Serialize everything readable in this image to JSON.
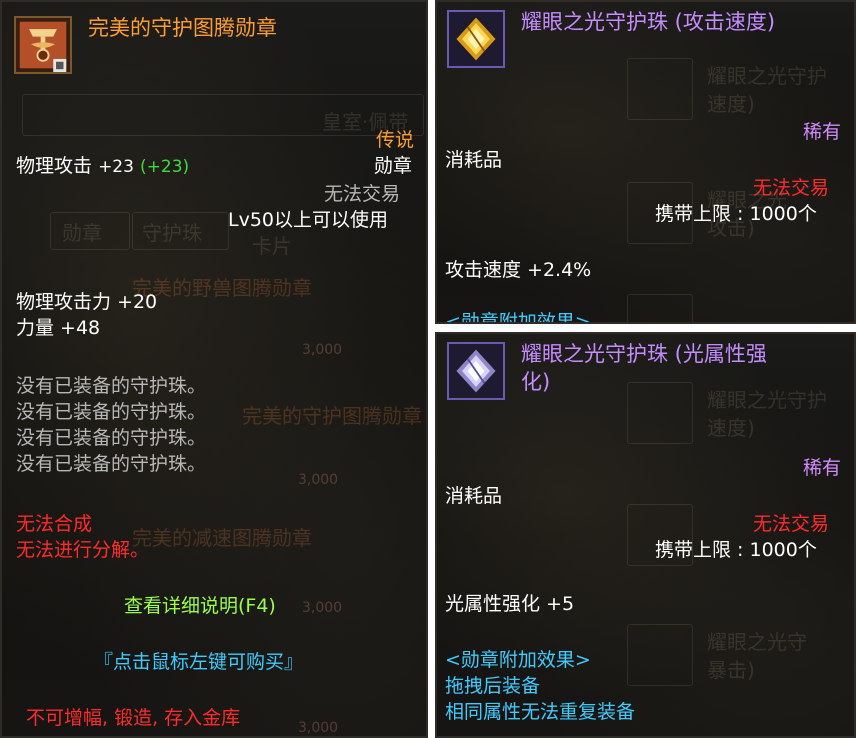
{
  "left": {
    "title": "完美的守护图腾勋章",
    "rarity": "传说",
    "category": "勋章",
    "attack_label": "物理攻击",
    "attack_value": "+23",
    "attack_bonus": "(+23)",
    "trade": "无法交易",
    "level_req": "Lv50以上可以使用",
    "stat1": "物理攻击力 +20",
    "stat2": "力量 +48",
    "empty_slot_1": "没有已装备的守护珠。",
    "empty_slot_2": "没有已装备的守护珠。",
    "empty_slot_3": "没有已装备的守护珠。",
    "empty_slot_4": "没有已装备的守护珠。",
    "no_craft": "无法合成",
    "no_disassemble": "无法进行分解。",
    "detail_link": "查看详细说明(F4)",
    "buy_hint": "『点击鼠标左键可购买』",
    "restrictions": "不可增幅, 锻造, 存入金库",
    "bg_text": {
      "royal": "皇室·佩带",
      "tab1": "勋章",
      "tab2": "守护珠",
      "tab3": "卡片",
      "item1": "完美的野兽图腾勋章",
      "item2": "完美的守护图腾勋章",
      "item3": "完美的减速图腾勋章",
      "price1": "3,000",
      "price2": "3,000",
      "price3": "3,000",
      "price4": "3,000"
    }
  },
  "right_top": {
    "title": "耀眼之光守护珠 (攻击速度)",
    "rarity": "稀有",
    "type": "消耗品",
    "trade": "无法交易",
    "stack_limit": "携带上限 : 1000个",
    "effect": "攻击速度 +2.4%",
    "medal_effect_header": "<勋章附加效果>",
    "bg_text": {
      "item1": "耀眼之光守护",
      "item1b": "速度)",
      "item2": "耀眼之光",
      "item2b": "攻击)"
    }
  },
  "right_bottom": {
    "title_line1": "耀眼之光守护珠 (光属性强",
    "title_line2": "化)",
    "rarity": "稀有",
    "type": "消耗品",
    "trade": "无法交易",
    "stack_limit": "携带上限 : 1000个",
    "effect": "光属性强化 +5",
    "medal_effect_header": "<勋章附加效果>",
    "equip_hint": "拖拽后装备",
    "equip_rule": "相同属性无法重复装备",
    "bg_text": {
      "item1": "耀眼之光守护",
      "item1b": "速度)",
      "item2": "耀眼之光守",
      "item2b": "暴击)"
    }
  },
  "colors": {
    "title_orange": "#ff9e2e",
    "title_purple": "#c58cff",
    "white": "#ffffff",
    "green": "#3ddc3d",
    "gray": "#b7b7b7",
    "red": "#ff2b2b",
    "light_green": "#9cff47",
    "cyan": "#3ecbff",
    "purple_rare": "#d28bff"
  }
}
